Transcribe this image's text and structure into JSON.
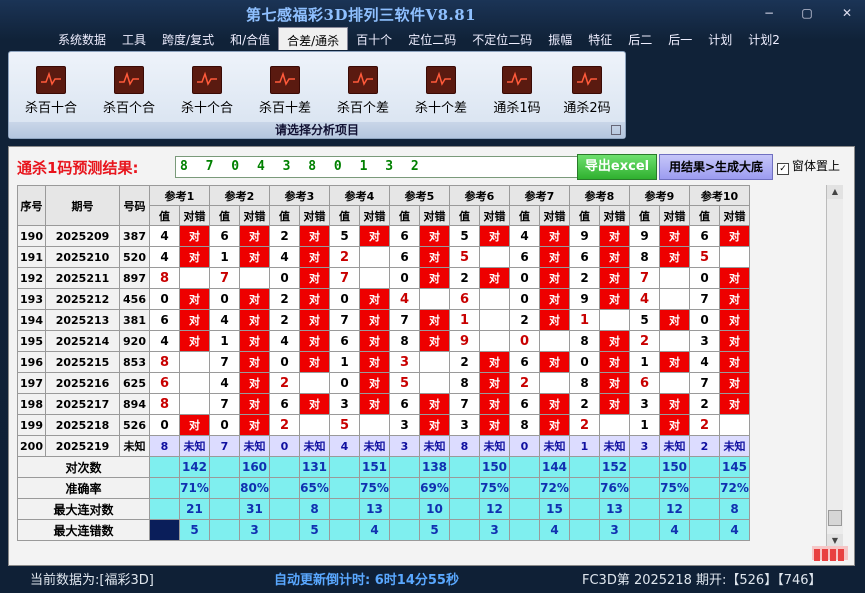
{
  "app": {
    "title": "第七感福彩3D排列三软件V8.81",
    "window_buttons": [
      "−",
      "▢",
      "✕"
    ]
  },
  "menu": [
    "系统数据",
    "工具",
    "跨度/复式",
    "和/合值",
    "合差/通杀",
    "百十个",
    "定位二码",
    "不定位二码",
    "振幅",
    "特征",
    "后二",
    "后一",
    "计划",
    "计划2"
  ],
  "menu_active": "合差/通杀",
  "ribbon": {
    "buttons": [
      "杀百十合",
      "杀百个合",
      "杀十个合",
      "杀百十差",
      "杀百个差",
      "杀十个差",
      "通杀1码",
      "通杀2码"
    ],
    "caption": "请选择分析项目"
  },
  "prediction": {
    "label": "通杀1码预测结果:",
    "value": "8 7 0 4 3 8 0 1 3 2",
    "excel_button": "导出excel",
    "generate_button": "用结果>生成大底",
    "topmost_label": "窗体置上",
    "topmost_checked": true
  },
  "table": {
    "head": {
      "seq": "序号",
      "period": "期号",
      "number": "号码",
      "value": "值",
      "result": "对错"
    },
    "ref_headers": [
      "参考1",
      "参考2",
      "参考3",
      "参考4",
      "参考5",
      "参考6",
      "参考7",
      "参考8",
      "参考9",
      "参考10"
    ],
    "hit_text": "对",
    "rows": [
      {
        "seq": "190",
        "period": "2025209",
        "number": "387",
        "cells": [
          [
            "4",
            "h"
          ],
          [
            "6",
            "h"
          ],
          [
            "2",
            "h"
          ],
          [
            "5",
            "h"
          ],
          [
            "6",
            "h"
          ],
          [
            "5",
            "h"
          ],
          [
            "4",
            "h"
          ],
          [
            "9",
            "h"
          ],
          [
            "9",
            "h"
          ],
          [
            "6",
            "h"
          ]
        ]
      },
      {
        "seq": "191",
        "period": "2025210",
        "number": "520",
        "cells": [
          [
            "4",
            "h"
          ],
          [
            "1",
            "h"
          ],
          [
            "4",
            "h"
          ],
          [
            "2",
            "m"
          ],
          [
            "6",
            "h"
          ],
          [
            "5",
            "m"
          ],
          [
            "6",
            "h"
          ],
          [
            "6",
            "h"
          ],
          [
            "8",
            "h"
          ],
          [
            "5",
            "m"
          ]
        ]
      },
      {
        "seq": "192",
        "period": "2025211",
        "number": "897",
        "cells": [
          [
            "8",
            "m"
          ],
          [
            "7",
            "m"
          ],
          [
            "0",
            "h"
          ],
          [
            "7",
            "m"
          ],
          [
            "0",
            "h"
          ],
          [
            "2",
            "h"
          ],
          [
            "0",
            "h"
          ],
          [
            "2",
            "h"
          ],
          [
            "7",
            "m"
          ],
          [
            "0",
            "h"
          ]
        ]
      },
      {
        "seq": "193",
        "period": "2025212",
        "number": "456",
        "cells": [
          [
            "0",
            "h"
          ],
          [
            "0",
            "h"
          ],
          [
            "2",
            "h"
          ],
          [
            "0",
            "h"
          ],
          [
            "4",
            "m"
          ],
          [
            "6",
            "m"
          ],
          [
            "0",
            "h"
          ],
          [
            "9",
            "h"
          ],
          [
            "4",
            "m"
          ],
          [
            "7",
            "h"
          ]
        ]
      },
      {
        "seq": "194",
        "period": "2025213",
        "number": "381",
        "cells": [
          [
            "6",
            "h"
          ],
          [
            "4",
            "h"
          ],
          [
            "2",
            "h"
          ],
          [
            "7",
            "h"
          ],
          [
            "7",
            "h"
          ],
          [
            "1",
            "m"
          ],
          [
            "2",
            "h"
          ],
          [
            "1",
            "m"
          ],
          [
            "5",
            "h"
          ],
          [
            "0",
            "h"
          ]
        ]
      },
      {
        "seq": "195",
        "period": "2025214",
        "number": "920",
        "cells": [
          [
            "4",
            "h"
          ],
          [
            "1",
            "h"
          ],
          [
            "4",
            "h"
          ],
          [
            "6",
            "h"
          ],
          [
            "8",
            "h"
          ],
          [
            "9",
            "m"
          ],
          [
            "0",
            "m"
          ],
          [
            "8",
            "h"
          ],
          [
            "2",
            "m"
          ],
          [
            "3",
            "h"
          ]
        ]
      },
      {
        "seq": "196",
        "period": "2025215",
        "number": "853",
        "cells": [
          [
            "8",
            "m"
          ],
          [
            "7",
            "h"
          ],
          [
            "0",
            "h"
          ],
          [
            "1",
            "h"
          ],
          [
            "3",
            "m"
          ],
          [
            "2",
            "h"
          ],
          [
            "6",
            "h"
          ],
          [
            "0",
            "h"
          ],
          [
            "1",
            "h"
          ],
          [
            "4",
            "h"
          ]
        ]
      },
      {
        "seq": "197",
        "period": "2025216",
        "number": "625",
        "cells": [
          [
            "6",
            "m"
          ],
          [
            "4",
            "h"
          ],
          [
            "2",
            "m"
          ],
          [
            "0",
            "h"
          ],
          [
            "5",
            "m"
          ],
          [
            "8",
            "h"
          ],
          [
            "2",
            "m"
          ],
          [
            "8",
            "h"
          ],
          [
            "6",
            "m"
          ],
          [
            "7",
            "h"
          ]
        ]
      },
      {
        "seq": "198",
        "period": "2025217",
        "number": "894",
        "cells": [
          [
            "8",
            "m"
          ],
          [
            "7",
            "h"
          ],
          [
            "6",
            "h"
          ],
          [
            "3",
            "h"
          ],
          [
            "6",
            "h"
          ],
          [
            "7",
            "h"
          ],
          [
            "6",
            "h"
          ],
          [
            "2",
            "h"
          ],
          [
            "3",
            "h"
          ],
          [
            "2",
            "h"
          ]
        ]
      },
      {
        "seq": "199",
        "period": "2025218",
        "number": "526",
        "cells": [
          [
            "0",
            "h"
          ],
          [
            "0",
            "h"
          ],
          [
            "2",
            "m"
          ],
          [
            "5",
            "m"
          ],
          [
            "3",
            "h"
          ],
          [
            "3",
            "h"
          ],
          [
            "8",
            "h"
          ],
          [
            "2",
            "m"
          ],
          [
            "1",
            "h"
          ],
          [
            "2",
            "m"
          ]
        ]
      }
    ],
    "last_row": {
      "seq": "200",
      "period": "2025219",
      "number": "未知",
      "values": [
        "8",
        "7",
        "0",
        "4",
        "3",
        "8",
        "0",
        "1",
        "3",
        "2"
      ],
      "status": "未知"
    },
    "stats": [
      {
        "label": "对次数",
        "values": [
          "142",
          "160",
          "131",
          "151",
          "138",
          "150",
          "144",
          "152",
          "150",
          "145"
        ]
      },
      {
        "label": "准确率",
        "values": [
          "71%",
          "80%",
          "65%",
          "75%",
          "69%",
          "75%",
          "72%",
          "76%",
          "75%",
          "72%"
        ]
      },
      {
        "label": "最大连对数",
        "values": [
          "21",
          "31",
          "8",
          "13",
          "10",
          "12",
          "15",
          "13",
          "12",
          "8"
        ]
      },
      {
        "label": "最大连错数",
        "values": [
          "5",
          "3",
          "5",
          "4",
          "5",
          "3",
          "4",
          "3",
          "4",
          "4"
        ]
      }
    ]
  },
  "status_bar": {
    "current_data": "当前数据为:[福彩3D]",
    "countdown": "自动更新倒计时: 6时14分55秒",
    "draw_info": "FC3D第 2025218 期开:【526】【746】"
  },
  "colors": {
    "hit": "#ee0000",
    "miss_text": "#c80000",
    "stats_bg": "#7fefef",
    "title": "#8fc0ff",
    "prediction_text": "#008000"
  }
}
